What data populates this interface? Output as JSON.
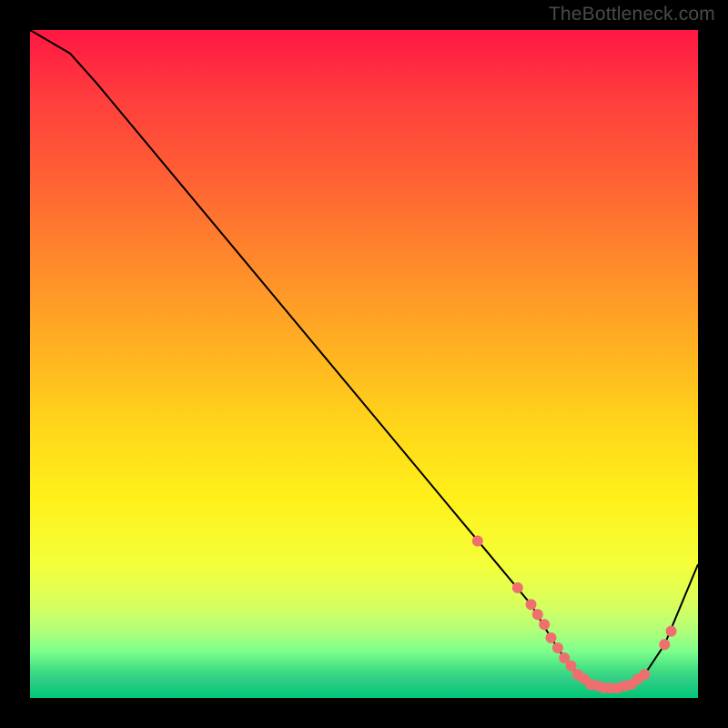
{
  "watermark": "TheBottleneck.com",
  "chart_data": {
    "type": "line",
    "title": "",
    "xlabel": "",
    "ylabel": "",
    "xlim": [
      0,
      100
    ],
    "ylim": [
      0,
      100
    ],
    "grid": false,
    "legend": false,
    "series": [
      {
        "name": "bottleneck-curve",
        "x": [
          0,
          6,
          10,
          20,
          30,
          40,
          50,
          60,
          65,
          70,
          75,
          78,
          80,
          82,
          84,
          86,
          88,
          90,
          92,
          95,
          100
        ],
        "y": [
          100,
          96.5,
          92,
          80,
          68,
          56,
          44,
          32,
          26,
          20,
          14,
          9,
          6,
          3.5,
          2,
          1.5,
          1.5,
          2,
          3.5,
          8,
          20
        ]
      }
    ],
    "markers": {
      "name": "highlight-dots",
      "x": [
        67,
        73,
        75,
        76,
        77,
        78,
        79,
        80,
        81,
        82,
        83,
        84,
        85,
        86,
        87,
        88,
        89,
        90,
        91,
        92,
        95,
        96
      ],
      "y": [
        23.5,
        16.5,
        14,
        12.5,
        11,
        9,
        7.5,
        6,
        4.8,
        3.5,
        2.8,
        2,
        1.8,
        1.5,
        1.5,
        1.5,
        1.8,
        2,
        2.8,
        3.5,
        8,
        10
      ],
      "color": "#ef6f6f"
    }
  }
}
